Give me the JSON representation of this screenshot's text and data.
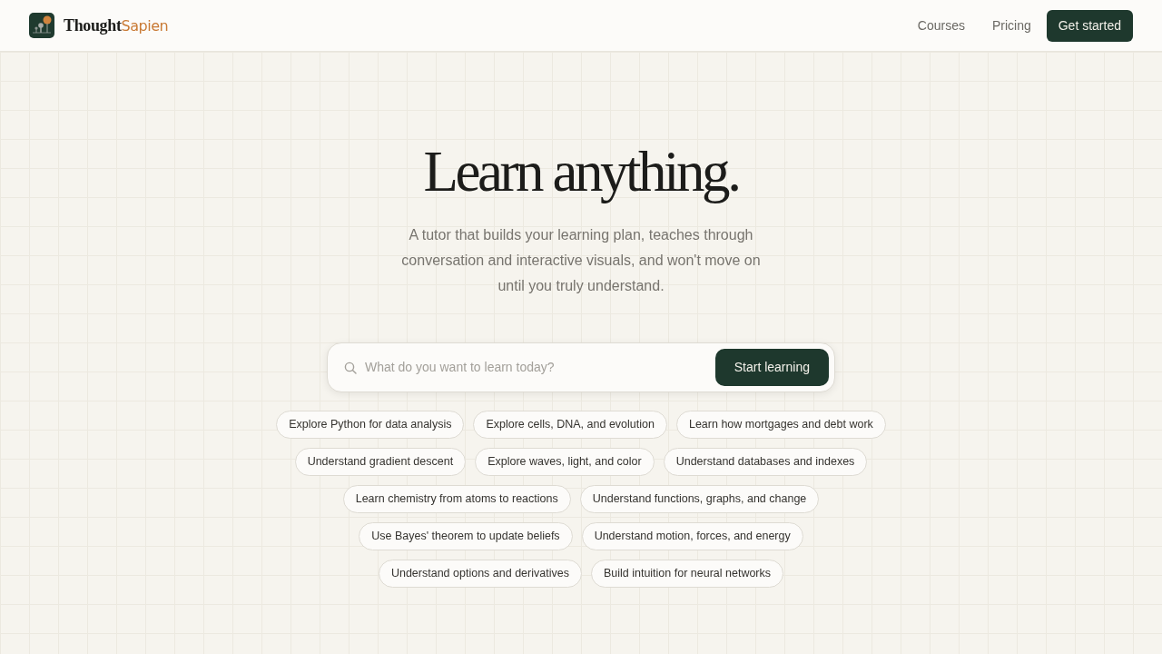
{
  "header": {
    "brand": {
      "name_primary": "Thought",
      "name_accent": "Sapien"
    },
    "nav_links": [
      "Courses",
      "Pricing"
    ],
    "cta_button": "Get started"
  },
  "hero": {
    "title": "Learn anything.",
    "subtitle": "A tutor that builds your learning plan, teaches through conversation and interactive visuals, and won't move on until you truly understand.",
    "search": {
      "placeholder": "What do you want to learn today?",
      "button": "Start learning"
    },
    "suggestions": [
      "Explore Python for data analysis",
      "Explore cells, DNA, and evolution",
      "Learn how mortgages and debt work",
      "Understand gradient descent",
      "Explore waves, light, and color",
      "Understand databases and indexes",
      "Learn chemistry from atoms to reactions",
      "Understand functions, graphs, and change",
      "Use Bayes' theorem to update beliefs",
      "Understand motion, forces, and energy",
      "Understand options and derivatives",
      "Build intuition for neural networks"
    ]
  }
}
